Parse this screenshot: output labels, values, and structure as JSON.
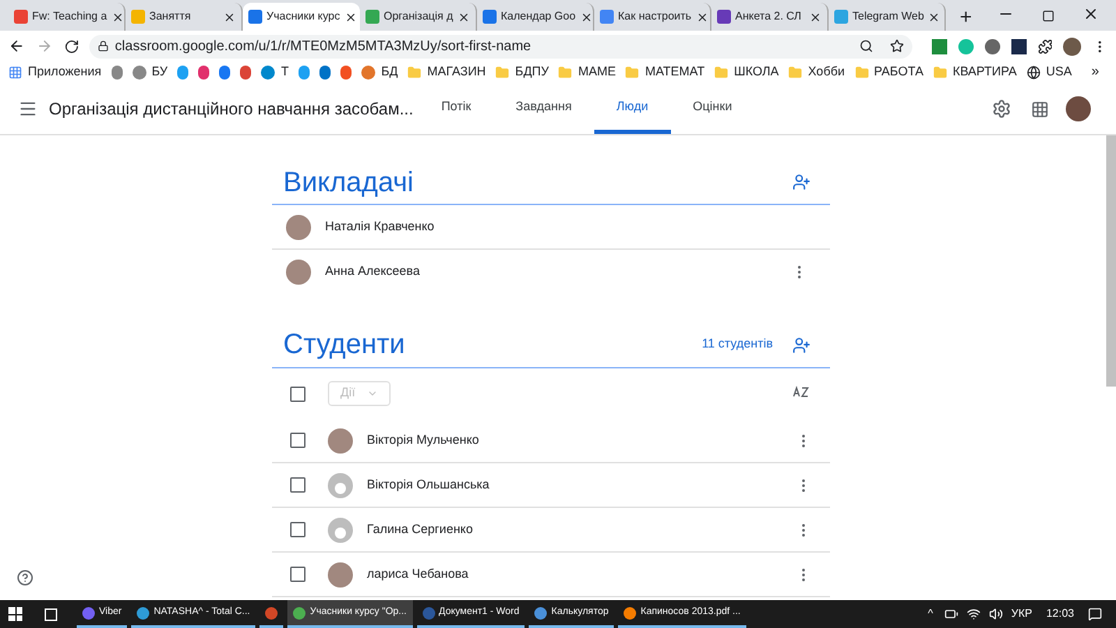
{
  "browser": {
    "tabs": [
      {
        "title": "Fw: Teaching a",
        "selected": false
      },
      {
        "title": "Заняття",
        "selected": false
      },
      {
        "title": "Учасники курс",
        "selected": true
      },
      {
        "title": "Організація д",
        "selected": false
      },
      {
        "title": "Календар Goo",
        "selected": false
      },
      {
        "title": "Как настроить",
        "selected": false
      },
      {
        "title": "Анкета 2. СЛ",
        "selected": false
      },
      {
        "title": "Telegram Web",
        "selected": false
      }
    ],
    "new_tab": "+",
    "url": "classroom.google.com/u/1/r/MTE0MzM5MTA3MzUy/sort-first-name",
    "bookmarks": [
      {
        "kind": "apps",
        "label": "Приложения"
      },
      {
        "kind": "icon"
      },
      {
        "kind": "site",
        "label": "БУ"
      },
      {
        "kind": "icon"
      },
      {
        "kind": "icon"
      },
      {
        "kind": "icon"
      },
      {
        "kind": "icon"
      },
      {
        "kind": "site",
        "label": "Т"
      },
      {
        "kind": "icon"
      },
      {
        "kind": "icon"
      },
      {
        "kind": "icon"
      },
      {
        "kind": "site",
        "label": "БД"
      },
      {
        "kind": "folder",
        "label": "МАГАЗИН"
      },
      {
        "kind": "folder",
        "label": "БДПУ"
      },
      {
        "kind": "folder",
        "label": "МАМЕ"
      },
      {
        "kind": "folder",
        "label": "МАТЕМАТ"
      },
      {
        "kind": "folder",
        "label": "ШКОЛА"
      },
      {
        "kind": "folder",
        "label": "Хобби"
      },
      {
        "kind": "folder",
        "label": "РАБОТА"
      },
      {
        "kind": "folder",
        "label": "КВАРТИРА"
      },
      {
        "kind": "globe",
        "label": "USA"
      }
    ],
    "more_bookmarks": "»"
  },
  "classroom": {
    "title": "Організація дистанційного навчання засобам...",
    "tabs": [
      {
        "label": "Потік",
        "selected": false
      },
      {
        "label": "Завдання",
        "selected": false
      },
      {
        "label": "Люди",
        "selected": true
      },
      {
        "label": "Оцінки",
        "selected": false
      }
    ],
    "teachers": {
      "heading": "Викладачі",
      "people": [
        {
          "name": "Наталія Кравченко",
          "kind": "photo",
          "has_menu": false
        },
        {
          "name": "Анна Алексеева",
          "kind": "photo",
          "has_menu": true
        }
      ]
    },
    "students": {
      "heading": "Студенти",
      "count": "11 студентів",
      "select_all_checked": false,
      "actions": "Дії",
      "actions_disabled": true,
      "people": [
        {
          "name": "Вікторія Мульченко",
          "kind": "photo",
          "checked": false
        },
        {
          "name": "Вікторія Ольшанська",
          "kind": "default",
          "checked": false
        },
        {
          "name": "Галина Сергиенко",
          "kind": "default",
          "checked": false
        },
        {
          "name": "лариса Чебанова",
          "kind": "photo",
          "checked": false
        }
      ]
    }
  },
  "taskbar": {
    "items": [
      {
        "label": "Viber",
        "selected": false
      },
      {
        "label": "NATASHA^ - Total C...",
        "selected": false
      },
      {
        "selected": false
      },
      {
        "label": "Учасники курсу \"Ор...",
        "selected": true
      },
      {
        "label": "Документ1 - Word",
        "selected": false
      },
      {
        "label": "Калькулятор",
        "selected": false
      },
      {
        "label": "Капиносов 2013.pdf ...",
        "selected": false
      }
    ],
    "tray_arrow": "^",
    "language": "УКР",
    "time": "12:03"
  }
}
